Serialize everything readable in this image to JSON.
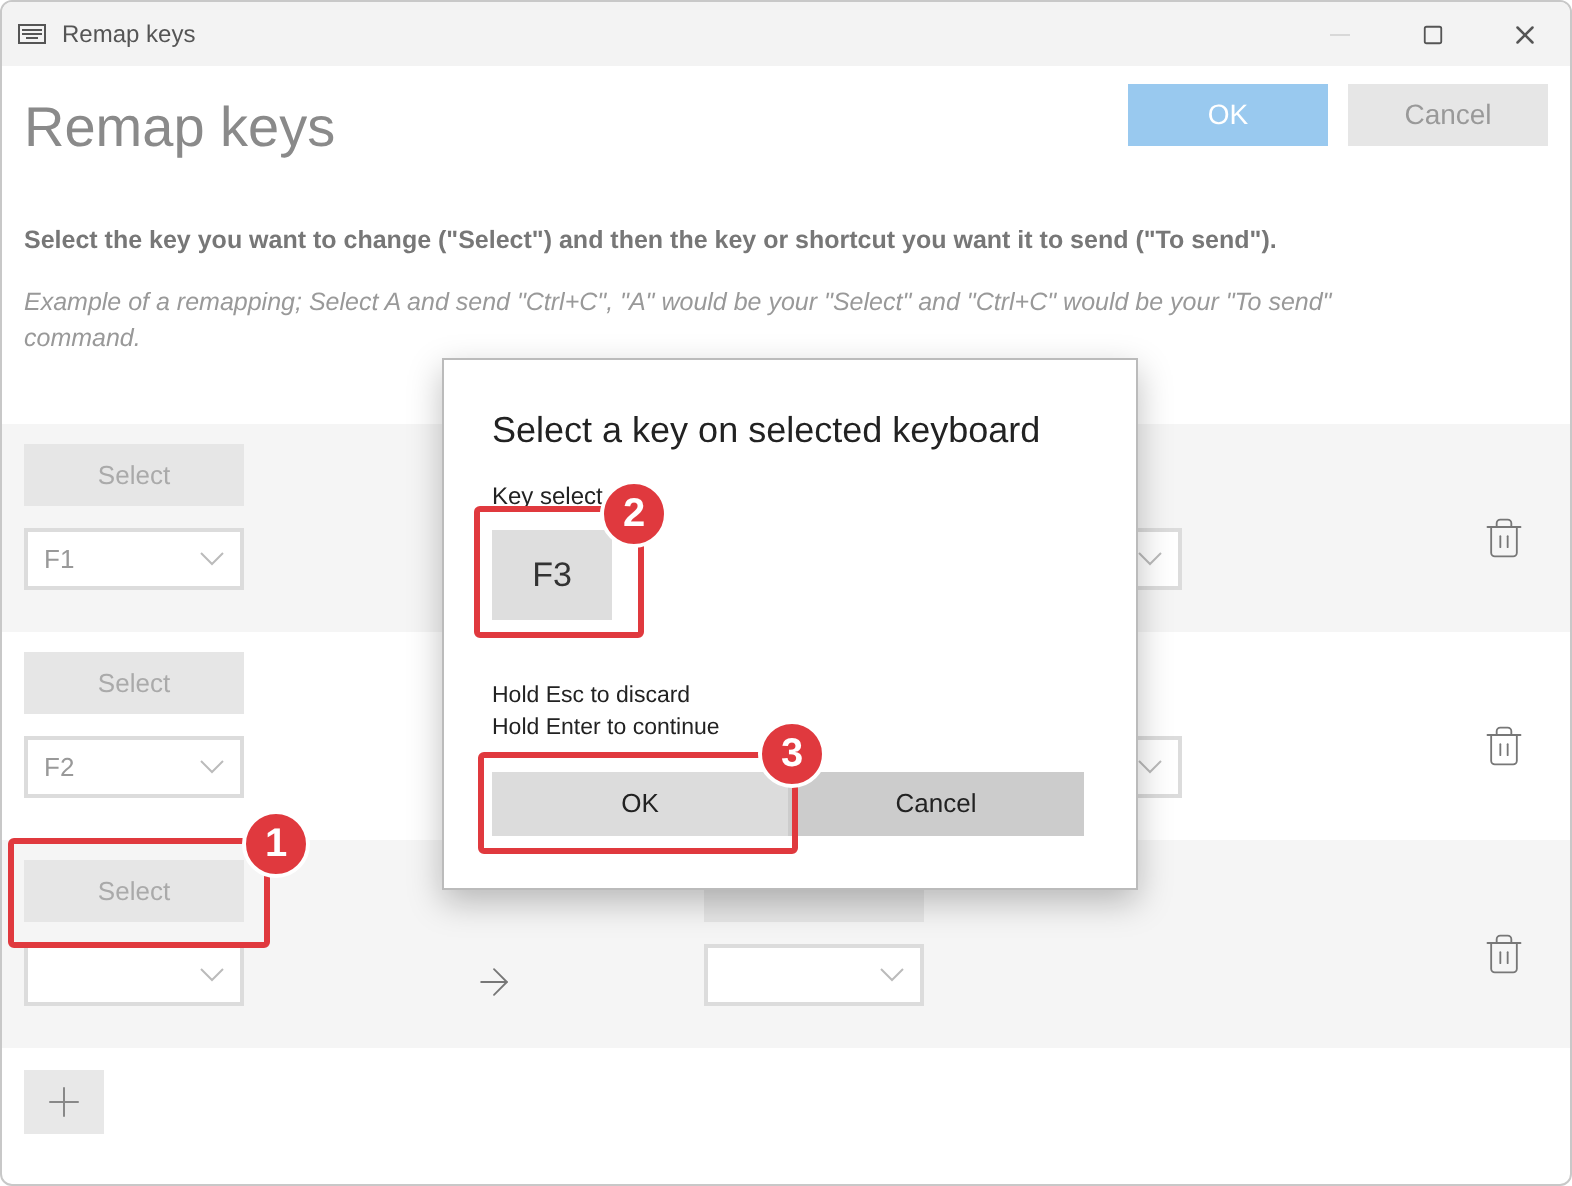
{
  "window": {
    "title": "Remap keys"
  },
  "header": {
    "title": "Remap keys",
    "buttons": [
      {
        "label": "OK",
        "kind": "primary"
      },
      {
        "label": "Cancel",
        "kind": "secondary"
      }
    ]
  },
  "instruction": "Select the key you want to change (\"Select\") and then the key or shortcut you want it to send (\"To send\").",
  "example": "Example of a remapping; Select A and send \"Ctrl+C\", \"A\" would be your \"Select\" and \"Ctrl+C\" would be your \"To send\" command.",
  "rows": [
    {
      "kind": "assigned",
      "select_label": "Select",
      "original_key": "F1"
    },
    {
      "kind": "assigned",
      "select_label": "Select",
      "original_key": "F2"
    },
    {
      "kind": "pending",
      "select_label": "Select",
      "original_key": ""
    }
  ],
  "dialog": {
    "title": "Select a key on selected keyboard",
    "label": "Key select",
    "key": "F3",
    "hints": [
      "Hold Esc to discard",
      "Hold Enter to continue"
    ],
    "buttons": [
      "OK",
      "Cancel"
    ]
  },
  "callouts": [
    {
      "number": "1"
    },
    {
      "number": "2"
    },
    {
      "number": "3"
    }
  ]
}
